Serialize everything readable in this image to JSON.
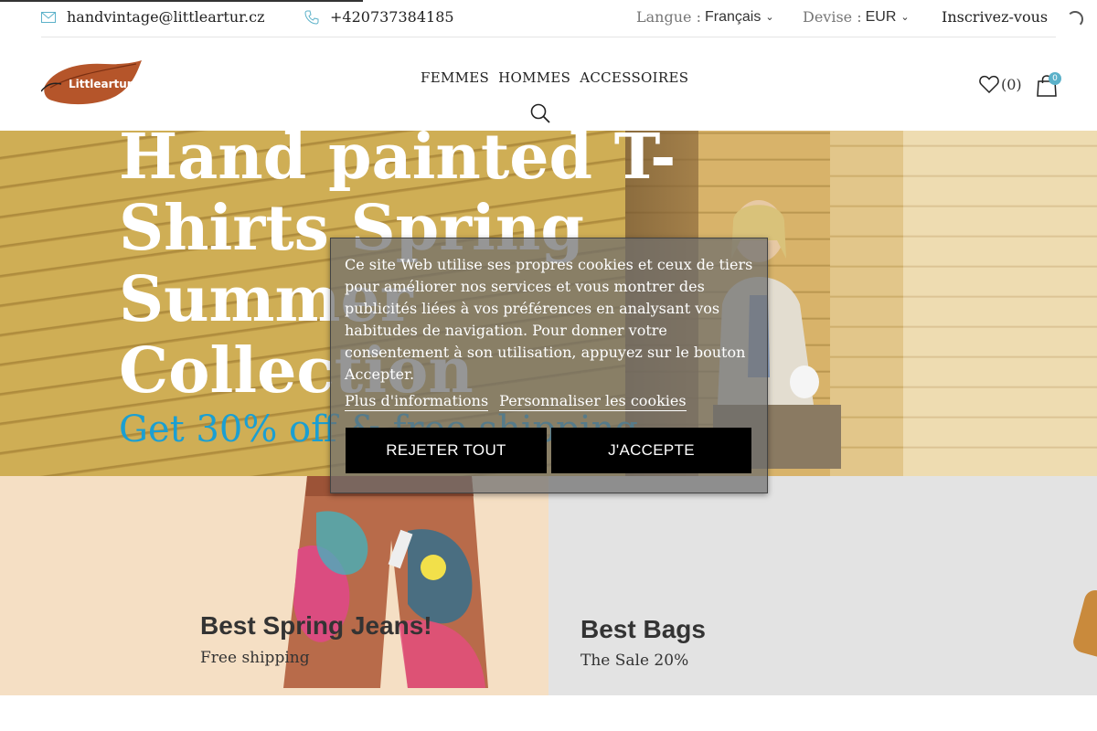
{
  "topbar": {
    "email": "handvintage@littleartur.cz",
    "phone": "+420737384185",
    "language_label": "Langue :",
    "language_value": "Français",
    "currency_label": "Devise :",
    "currency_value": "EUR",
    "signup": "Inscrivez-vous"
  },
  "header": {
    "logo_text": "Littleartur",
    "nav": [
      "FEMMES",
      "HOMMES",
      "ACCESSOIRES"
    ],
    "wishlist_count": "(0)",
    "cart_count": "0"
  },
  "hero": {
    "title": "Hand painted T-Shirts Spring Summer Collection",
    "subtitle": "Get 30% off & free shipping"
  },
  "banners": {
    "left": {
      "title": "Best Spring Jeans!",
      "subtitle": "Free shipping"
    },
    "right": {
      "title": "Best Bags",
      "subtitle": "The Sale 20%"
    }
  },
  "cookie": {
    "text": "Ce site Web utilise ses propres cookies et ceux de tiers pour améliorer nos services et vous montrer des publicités liées à vos préférences en analysant vos habitudes de navigation. Pour donner votre consentement à son utilisation, appuyez sur le bouton Accepter.",
    "more_info": "Plus d'informations",
    "customize": "Personnaliser les cookies",
    "reject": "REJETER TOUT",
    "accept": "J'ACCEPTE"
  },
  "colors": {
    "accent_blue": "#1b9fd2",
    "badge": "#5bb1c9",
    "banner_left_bg": "#f5dfc4",
    "banner_right_bg": "#e3e3e3"
  }
}
